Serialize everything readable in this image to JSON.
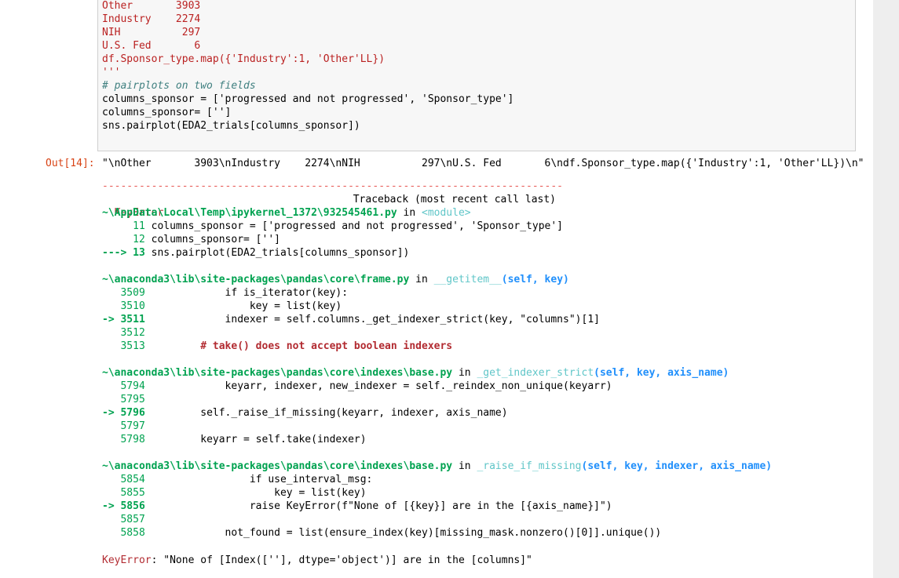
{
  "input_cell": {
    "lines": [
      {
        "text": "Other       3903",
        "style": "red"
      },
      {
        "text": "Industry    2274",
        "style": "red"
      },
      {
        "text": "NIH          297",
        "style": "red"
      },
      {
        "text": "U.S. Fed       6",
        "style": "red"
      },
      {
        "text": "df.Sponsor_type.map({'Industry':1, 'Other'LL})",
        "style": "red"
      },
      {
        "text": "'''",
        "style": "red"
      },
      {
        "text": "# pairplots on two fields",
        "style": "cmt"
      },
      {
        "text": "columns_sponsor = ['progressed and not progressed', 'Sponsor_type']",
        "style": "plain"
      },
      {
        "text": "columns_sponsor= ['']",
        "style": "plain"
      },
      {
        "text": "sns.pairplot(EDA2_trials[columns_sponsor])",
        "style": "plain"
      }
    ]
  },
  "output": {
    "prompt": "Out[14]:",
    "value": "\"\\nOther       3903\\nIndustry    2274\\nNIH          297\\nU.S. Fed       6\\ndf.Sponsor_type.map({'Industry':1, 'Other'LL})\\n\""
  },
  "traceback": {
    "dashes": "---------------------------------------------------------------------------",
    "error_name": "KeyError",
    "header_right": "Traceback (most recent call last)",
    "frame1": {
      "path": "~\\AppData\\Local\\Temp\\ipykernel_1372\\932545461.py",
      "in": " in ",
      "func": "<module>",
      "lines": [
        {
          "prefix": "     11 ",
          "code": "columns_sponsor = ['progressed and not progressed', 'Sponsor_type']"
        },
        {
          "prefix": "     12 ",
          "code": "columns_sponsor= ['']"
        },
        {
          "prefix": "---> 13 ",
          "code": "sns.pairplot(EDA2_trials[columns_sponsor])"
        }
      ]
    },
    "frame2": {
      "path": "~\\anaconda3\\lib\\site-packages\\pandas\\core\\frame.py",
      "in": " in ",
      "func": "__getitem__",
      "args": "(self, key)",
      "lines": [
        {
          "prefix": "   3509 ",
          "code": "            if is_iterator(key):"
        },
        {
          "prefix": "   3510 ",
          "code": "                key = list(key)"
        },
        {
          "prefix": "-> 3511 ",
          "code": "            indexer = self.columns._get_indexer_strict(key, \"columns\")[1]"
        },
        {
          "prefix": "   3512 ",
          "code": ""
        },
        {
          "prefix": "   3513 ",
          "code": "        # take() does not accept boolean indexers"
        }
      ]
    },
    "frame3": {
      "path": "~\\anaconda3\\lib\\site-packages\\pandas\\core\\indexes\\base.py",
      "in": " in ",
      "func": "_get_indexer_strict",
      "args": "(self, key, axis_name)",
      "lines": [
        {
          "prefix": "   5794 ",
          "code": "            keyarr, indexer, new_indexer = self._reindex_non_unique(keyarr)"
        },
        {
          "prefix": "   5795 ",
          "code": ""
        },
        {
          "prefix": "-> 5796 ",
          "code": "        self._raise_if_missing(keyarr, indexer, axis_name)"
        },
        {
          "prefix": "   5797 ",
          "code": ""
        },
        {
          "prefix": "   5798 ",
          "code": "        keyarr = self.take(indexer)"
        }
      ]
    },
    "frame4": {
      "path": "~\\anaconda3\\lib\\site-packages\\pandas\\core\\indexes\\base.py",
      "in": " in ",
      "func": "_raise_if_missing",
      "args": "(self, key, indexer, axis_name)",
      "lines": [
        {
          "prefix": "   5854 ",
          "code": "                if use_interval_msg:"
        },
        {
          "prefix": "   5855 ",
          "code": "                    key = list(key)"
        },
        {
          "prefix": "-> 5856 ",
          "code": "                raise KeyError(f\"None of [{key}] are in the [{axis_name}]\")"
        },
        {
          "prefix": "   5857 ",
          "code": ""
        },
        {
          "prefix": "   5858 ",
          "code": "            not_found = list(ensure_index(key)[missing_mask.nonzero()[0]].unique())"
        }
      ]
    },
    "final_name": "KeyError",
    "final_message": ": \"None of [Index([''], dtype='object')] are in the [columns]\""
  }
}
